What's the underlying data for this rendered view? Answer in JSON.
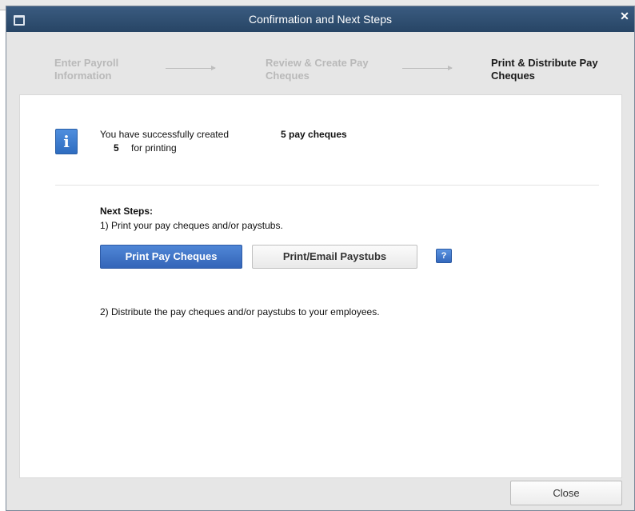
{
  "window": {
    "title": "Confirmation and Next Steps"
  },
  "steps": [
    {
      "label_line1": "Enter Payroll",
      "label_line2": "Information",
      "state": "done"
    },
    {
      "label_line1": "Review & Create Pay",
      "label_line2": "Cheques",
      "state": "done"
    },
    {
      "label_line1": "Print & Distribute Pay",
      "label_line2": "Cheques",
      "state": "active"
    }
  ],
  "confirmation": {
    "created_text": "You have successfully created",
    "created_value": "5 pay cheques",
    "printing_count": "5",
    "printing_text": "for printing"
  },
  "next_steps": {
    "heading": "Next Steps:",
    "step1": "1) Print your pay cheques and/or paystubs.",
    "step2": "2) Distribute the pay cheques and/or paystubs to your employees."
  },
  "buttons": {
    "print_pay_cheques": "Print Pay Cheques",
    "print_email_paystubs": "Print/Email Paystubs",
    "help": "?",
    "close": "Close"
  },
  "icons": {
    "info": "info-icon",
    "window": "window-icon",
    "close": "close-icon"
  },
  "colors": {
    "titlebar": "#2e4d6f",
    "primary_button": "#3f74c8"
  }
}
